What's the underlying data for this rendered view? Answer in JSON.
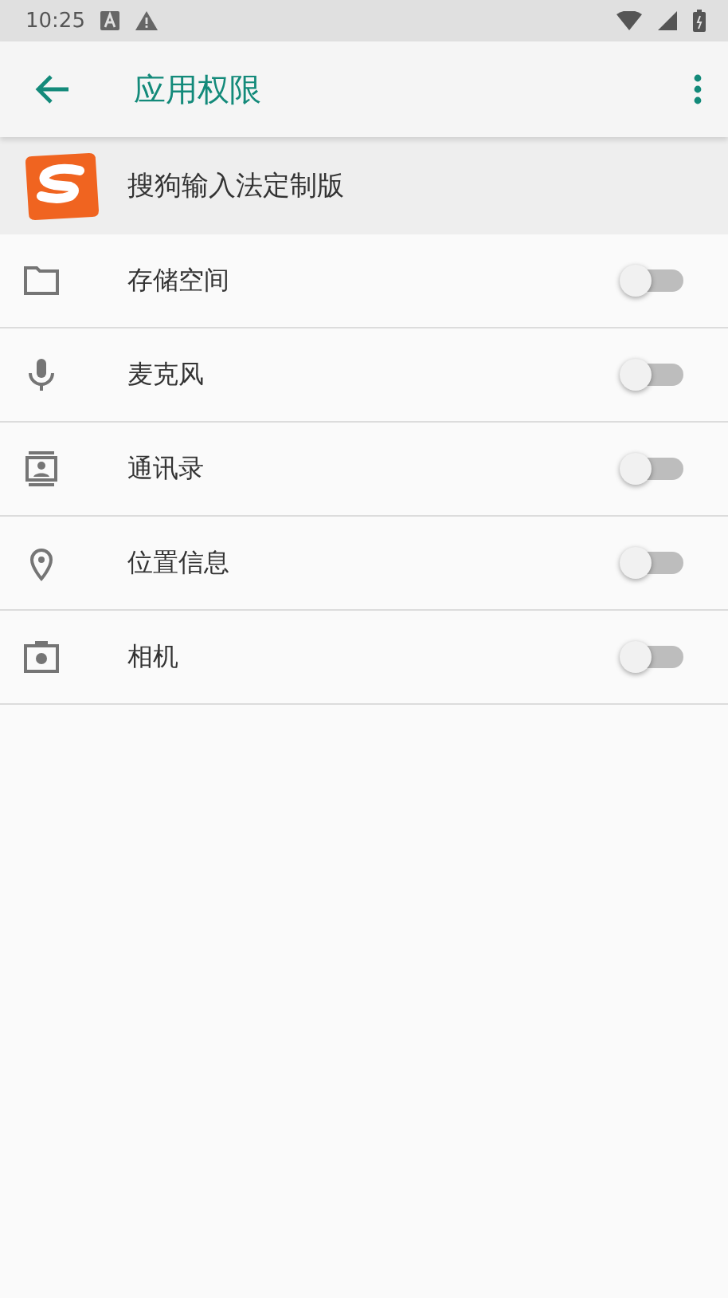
{
  "status_bar": {
    "time": "10:25"
  },
  "app_bar": {
    "title": "应用权限"
  },
  "app": {
    "name": "搜狗输入法定制版"
  },
  "permissions": [
    {
      "label": "存储空间",
      "on": false
    },
    {
      "label": "麦克风",
      "on": false
    },
    {
      "label": "通讯录",
      "on": false
    },
    {
      "label": "位置信息",
      "on": false
    },
    {
      "label": "相机",
      "on": false
    }
  ]
}
